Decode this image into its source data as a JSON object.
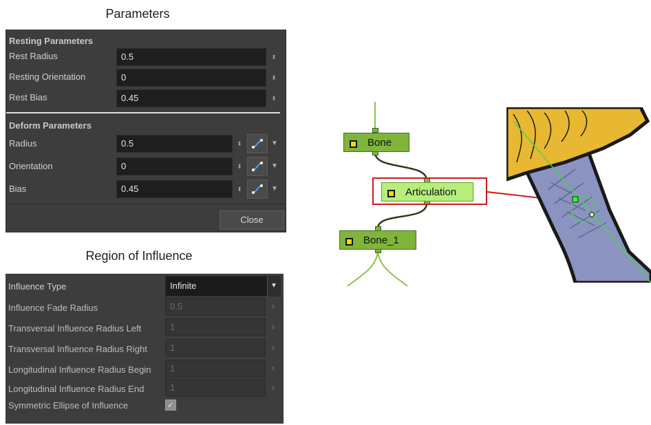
{
  "parameters": {
    "caption": "Parameters",
    "resting_section": "Resting Parameters",
    "resting_rows": [
      {
        "label": "Rest Radius",
        "value": "0.5"
      },
      {
        "label": "Resting Orientation",
        "value": "0"
      },
      {
        "label": "Rest Bias",
        "value": "0.45"
      }
    ],
    "deform_section": "Deform Parameters",
    "deform_rows": [
      {
        "label": "Radius",
        "value": "0.5"
      },
      {
        "label": "Orientation",
        "value": "0"
      },
      {
        "label": "Bias",
        "value": "0.45"
      }
    ],
    "close_label": "Close",
    "spin_glyph": "⬍",
    "dropdown_glyph": "▼"
  },
  "influence": {
    "caption": "Region of Influence",
    "type_label": "Influence Type",
    "type_value": "Infinite",
    "rows": [
      {
        "label": "Influence Fade Radius",
        "value": "0.5"
      },
      {
        "label": "Transversal Influence Radius Left",
        "value": "1"
      },
      {
        "label": "Transversal Influence Radius Right",
        "value": "1"
      },
      {
        "label": "Longitudinal Influence Radius Begin",
        "value": "1"
      },
      {
        "label": "Longitudinal Influence Radius End",
        "value": "1"
      }
    ],
    "symmetric_label": "Symmetric Ellipse of Influence",
    "symmetric_checked": true,
    "check_glyph": "✓"
  },
  "node_graph": {
    "nodes": [
      {
        "name": "Bone"
      },
      {
        "name": "Articulation"
      },
      {
        "name": "Bone_1"
      }
    ],
    "wire_color": "#2e3b1e",
    "connector_color": "#8cc34a",
    "highlight_color": "#d01818"
  },
  "colors": {
    "panel_bg": "#3d3d3d",
    "field_bg": "#1e1e1e",
    "node_green": "#7eb53a",
    "node_selected": "#b6ee7c",
    "art_yellow": "#e8b832",
    "art_blue": "#8b94c0",
    "art_outline": "#1a1a1a"
  }
}
